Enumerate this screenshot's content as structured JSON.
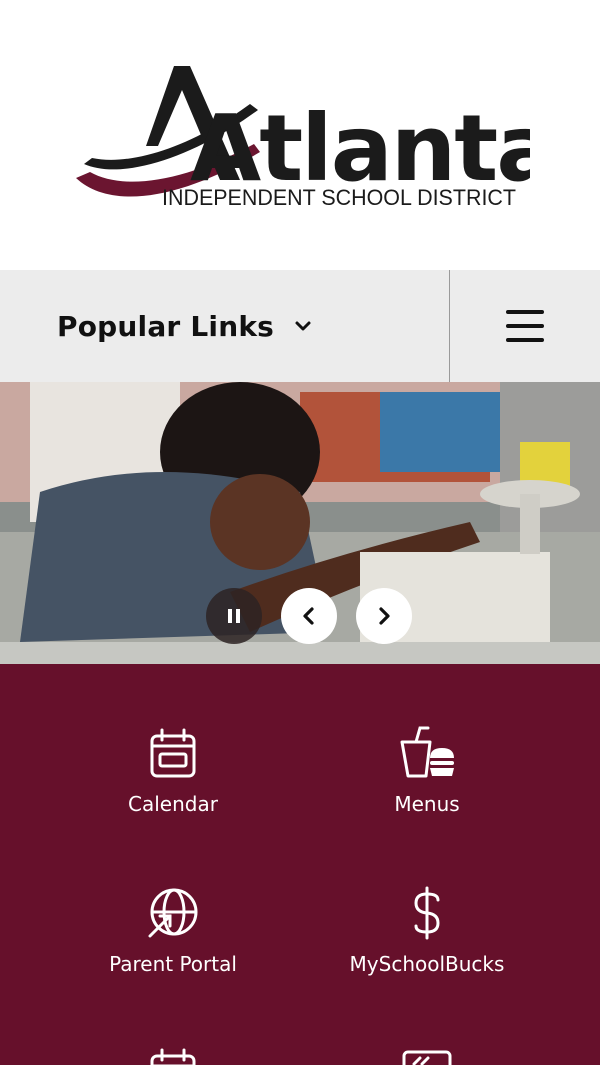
{
  "logo": {
    "wordmark": "Atlanta",
    "subtitle": "INDEPENDENT SCHOOL DISTRICT",
    "colors": {
      "dark": "#1b1b1b",
      "maroon": "#6b1530"
    }
  },
  "nav": {
    "popular_links_label": "Popular Links",
    "dropdown_icon": "chevron-down-icon",
    "menu_icon": "hamburger-menu-icon"
  },
  "hero": {
    "controls": {
      "pause_icon": "pause-icon",
      "prev_icon": "chevron-left-icon",
      "next_icon": "chevron-right-icon"
    }
  },
  "quick_links": {
    "background": "#66102b",
    "items": [
      {
        "label": "Calendar",
        "icon": "calendar-icon"
      },
      {
        "label": "Menus",
        "icon": "food-menu-icon"
      },
      {
        "label": "Parent Portal",
        "icon": "globe-arrow-icon"
      },
      {
        "label": "MySchoolBucks",
        "icon": "dollar-icon"
      },
      {
        "label": "",
        "icon": "calendar-icon"
      },
      {
        "label": "",
        "icon": "chalkboard-icon"
      }
    ]
  }
}
